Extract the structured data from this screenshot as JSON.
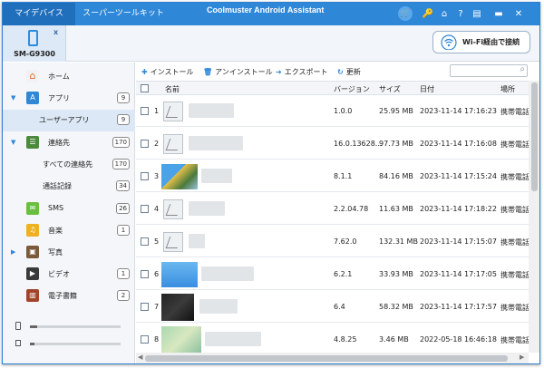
{
  "titlebar": {
    "tabs": [
      "マイデバイス",
      "スーパーツールキット"
    ],
    "app_title": "Coolmuster Android Assistant",
    "icons": [
      "cart-icon",
      "key-icon",
      "home-icon",
      "help-icon",
      "feedback-icon",
      "minimize-icon",
      "close-icon"
    ]
  },
  "device": {
    "name": "SM-G9300",
    "close": "x",
    "wifi_button": "Wi-Fi経由で接続"
  },
  "sidebar": {
    "items": [
      {
        "label": "ホーム",
        "badge": ""
      },
      {
        "label": "アプリ",
        "badge": "9"
      },
      {
        "label": "ユーザーアプリ",
        "badge": "9"
      },
      {
        "label": "連絡先",
        "badge": "170"
      },
      {
        "label": "すべての連絡先",
        "badge": "170"
      },
      {
        "label": "通話記録",
        "badge": "34"
      },
      {
        "label": "SMS",
        "badge": "26"
      },
      {
        "label": "音楽",
        "badge": "1"
      },
      {
        "label": "写真",
        "badge": ""
      },
      {
        "label": "ビデオ",
        "badge": "1"
      },
      {
        "label": "電子書籍",
        "badge": "2"
      }
    ],
    "storage_levels": [
      0.08,
      0.05
    ]
  },
  "toolbar": {
    "install": "インストール",
    "uninstall": "アンインストール",
    "export": "エクスポート",
    "refresh": "更新",
    "search_placeholder": ""
  },
  "table": {
    "headers": {
      "name": "名前",
      "version": "バージョン",
      "size": "サイズ",
      "date": "日付",
      "location": "場所"
    },
    "rows": [
      {
        "num": "1",
        "version": "1.0.0",
        "size": "25.95 MB",
        "date": "2023-11-14 17:16:23",
        "location": "携帯電話"
      },
      {
        "num": "2",
        "version": "16.0.13628...",
        "size": "97.73 MB",
        "date": "2023-11-14 17:16:08",
        "location": "携帯電話"
      },
      {
        "num": "3",
        "version": "8.1.1",
        "size": "84.16 MB",
        "date": "2023-11-14 17:15:24",
        "location": "携帯電話"
      },
      {
        "num": "4",
        "version": "2.2.04.78",
        "size": "11.63 MB",
        "date": "2023-11-14 17:18:22",
        "location": "携帯電話"
      },
      {
        "num": "5",
        "version": "7.62.0",
        "size": "132.31 MB",
        "date": "2023-11-14 17:15:07",
        "location": "携帯電話"
      },
      {
        "num": "6",
        "version": "6.2.1",
        "size": "33.93 MB",
        "date": "2023-11-14 17:17:05",
        "location": "携帯電話"
      },
      {
        "num": "7",
        "version": "6.4",
        "size": "58.32 MB",
        "date": "2023-11-14 17:17:57",
        "location": "携帯電話"
      },
      {
        "num": "8",
        "version": "4.8.25",
        "size": "3.46 MB",
        "date": "2022-05-18 16:46:18",
        "location": "携帯電話"
      }
    ]
  },
  "colors": {
    "accent": "#2f87d8",
    "titlebar": "#2f87d8",
    "selected": "#dce8f6"
  }
}
